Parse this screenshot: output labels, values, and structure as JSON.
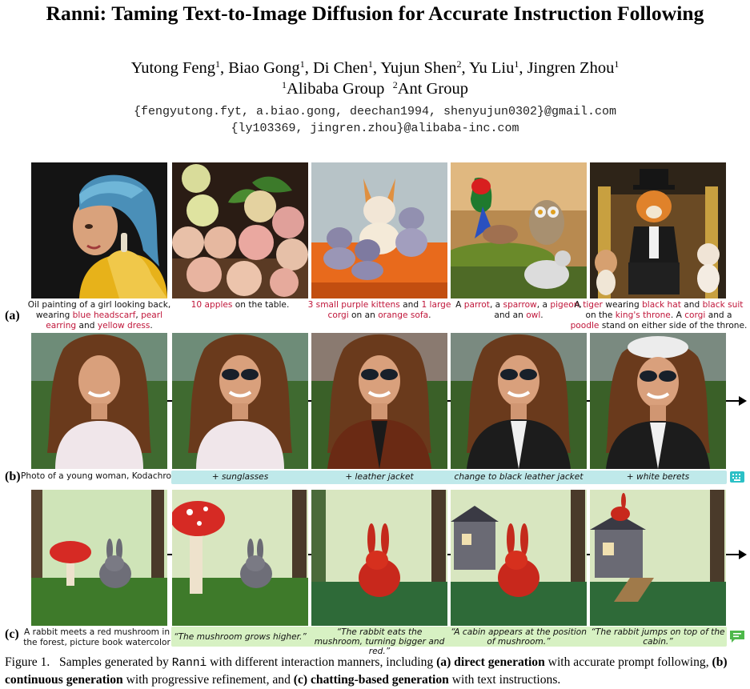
{
  "header": {
    "title": "Ranni: Taming Text-to-Image Diffusion for Accurate Instruction Following",
    "authors": [
      {
        "name": "Yutong Feng",
        "aff": "1"
      },
      {
        "name": "Biao Gong",
        "aff": "1"
      },
      {
        "name": "Di Chen",
        "aff": "1"
      },
      {
        "name": "Yujun Shen",
        "aff": "2"
      },
      {
        "name": "Yu Liu",
        "aff": "1"
      },
      {
        "name": "Jingren Zhou",
        "aff": "1"
      }
    ],
    "affiliations": [
      {
        "num": "1",
        "name": "Alibaba Group"
      },
      {
        "num": "2",
        "name": "Ant Group"
      }
    ],
    "emails": [
      "{fengyutong.fyt, a.biao.gong, deechan1994, shenyujun0302}@gmail.com",
      "{ly103369, jingren.zhou}@alibaba-inc.com"
    ]
  },
  "figure": {
    "row_a": {
      "label": "(a)",
      "captions": [
        [
          {
            "t": "Oil painting of a girl looking back, wearing "
          },
          {
            "t": "blue headscarf",
            "h": true
          },
          {
            "t": ", "
          },
          {
            "t": "pearl earring",
            "h": true
          },
          {
            "t": " and "
          },
          {
            "t": "yellow dress",
            "h": true
          },
          {
            "t": "."
          }
        ],
        [
          {
            "t": "10 apples",
            "h": true
          },
          {
            "t": " on the table."
          }
        ],
        [
          {
            "t": "3 small purple kittens",
            "h": true
          },
          {
            "t": " and "
          },
          {
            "t": "1 large corgi",
            "h": true
          },
          {
            "t": " on an "
          },
          {
            "t": "orange sofa",
            "h": true
          },
          {
            "t": "."
          }
        ],
        [
          {
            "t": "A "
          },
          {
            "t": "parrot",
            "h": true
          },
          {
            "t": ", a "
          },
          {
            "t": "sparrow",
            "h": true
          },
          {
            "t": ", a "
          },
          {
            "t": "pigeon",
            "h": true
          },
          {
            "t": ", and an "
          },
          {
            "t": "owl",
            "h": true
          },
          {
            "t": "."
          }
        ],
        [
          {
            "t": "A "
          },
          {
            "t": "tiger",
            "h": true
          },
          {
            "t": " wearing "
          },
          {
            "t": "black hat",
            "h": true
          },
          {
            "t": " and "
          },
          {
            "t": "black suit",
            "h": true
          },
          {
            "t": " on the "
          },
          {
            "t": "king's throne",
            "h": true
          },
          {
            "t": ". A "
          },
          {
            "t": "corgi",
            "h": true
          },
          {
            "t": " and a "
          },
          {
            "t": "poodle",
            "h": true
          },
          {
            "t": " stand on either side of the throne."
          }
        ]
      ]
    },
    "row_b": {
      "label": "(b)",
      "prompt": "Photo of a young woman, Kodachrome",
      "steps": [
        "+ sunglasses",
        "+ leather jacket",
        "change to black leather jacket",
        "+ white berets"
      ],
      "icon": "keyboard-icon"
    },
    "row_c": {
      "label": "(c)",
      "prompt": "A rabbit meets a red mushroom in the forest, picture book watercolor",
      "steps": [
        "“The mushroom grows higher.”",
        "“The rabbit eats the mushroom, turning bigger and red.”",
        "“A cabin appears at the position of mushroom.”",
        "“The rabbit jumps on top of the cabin.”"
      ],
      "icon": "chat-icon"
    }
  },
  "caption": {
    "label": "Figure 1.",
    "p1": "Samples generated by ",
    "name": "Ranni",
    "p2": " with different interaction manners, including ",
    "b1": "(a) direct generation",
    "p3": " with accurate prompt following, ",
    "b2": "(b) continuous generation",
    "p4": " with progressive refinement, and ",
    "b3": "(c) chatting-based generation",
    "p5": " with text instructions."
  },
  "colors": {
    "highlight": "#c0163a",
    "bar_b": "#bfe9ea",
    "bar_c": "#d7f1c3",
    "icon_b": "#2cc0c6",
    "icon_c": "#4db84a"
  }
}
